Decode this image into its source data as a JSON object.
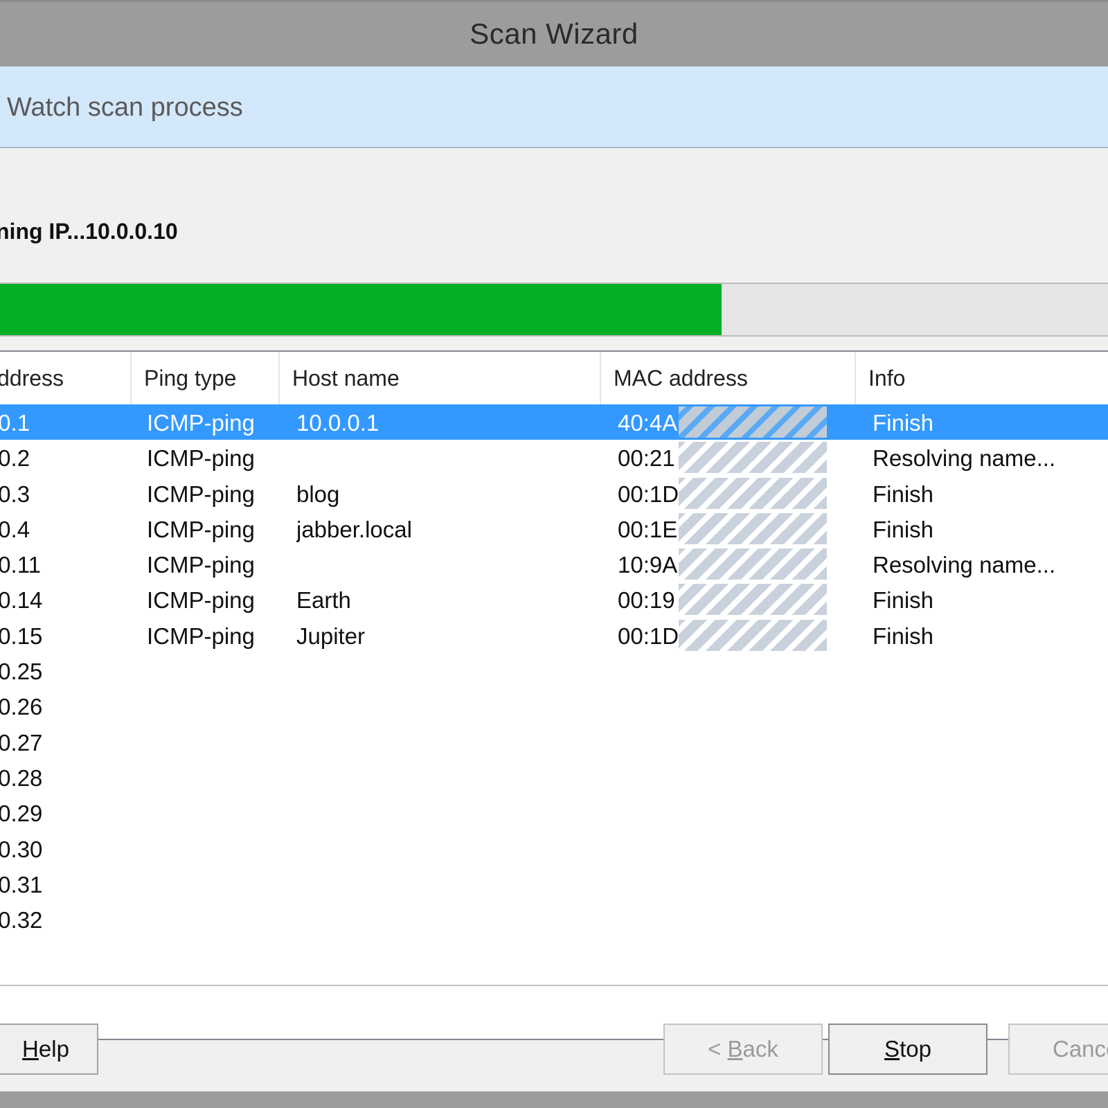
{
  "window": {
    "title": "Scan Wizard"
  },
  "banner": {
    "text": "Watch scan process"
  },
  "status": {
    "text": "ning IP...10.0.0.10"
  },
  "progress": {
    "fraction": 0.65,
    "fill_color": "#06b025"
  },
  "table": {
    "columns": [
      "ddress",
      "Ping type",
      "Host name",
      "MAC address",
      "Info"
    ],
    "rows": [
      {
        "address": ".0.1",
        "ping": "ICMP-ping",
        "host": "10.0.0.1",
        "mac": "40:4A",
        "info": "Finish",
        "selected": true
      },
      {
        "address": ".0.2",
        "ping": "ICMP-ping",
        "host": "",
        "mac": "00:21",
        "info": "Resolving name..."
      },
      {
        "address": ".0.3",
        "ping": "ICMP-ping",
        "host": "blog",
        "mac": "00:1D",
        "info": "Finish"
      },
      {
        "address": ".0.4",
        "ping": "ICMP-ping",
        "host": "jabber.local",
        "mac": "00:1E",
        "info": "Finish"
      },
      {
        "address": ".0.11",
        "ping": "ICMP-ping",
        "host": "",
        "mac": "10:9A",
        "info": "Resolving name..."
      },
      {
        "address": ".0.14",
        "ping": "ICMP-ping",
        "host": "Earth",
        "mac": "00:19",
        "info": "Finish"
      },
      {
        "address": ".0.15",
        "ping": "ICMP-ping",
        "host": "Jupiter",
        "mac": "00:1D",
        "info": "Finish"
      },
      {
        "address": ".0.25",
        "ping": "",
        "host": "",
        "mac": "",
        "info": ""
      },
      {
        "address": ".0.26",
        "ping": "",
        "host": "",
        "mac": "",
        "info": ""
      },
      {
        "address": ".0.27",
        "ping": "",
        "host": "",
        "mac": "",
        "info": ""
      },
      {
        "address": ".0.28",
        "ping": "",
        "host": "",
        "mac": "",
        "info": ""
      },
      {
        "address": ".0.29",
        "ping": "",
        "host": "",
        "mac": "",
        "info": ""
      },
      {
        "address": ".0.30",
        "ping": "",
        "host": "",
        "mac": "",
        "info": ""
      },
      {
        "address": ".0.31",
        "ping": "",
        "host": "",
        "mac": "",
        "info": ""
      },
      {
        "address": ".0.32",
        "ping": "",
        "host": "",
        "mac": "",
        "info": ""
      }
    ]
  },
  "buttons": {
    "help": {
      "prefix": "",
      "accel": "H",
      "rest": "elp"
    },
    "back": {
      "prefix": "< ",
      "accel": "B",
      "rest": "ack"
    },
    "stop": {
      "prefix": "",
      "accel": "S",
      "rest": "top"
    },
    "cancel": {
      "label": "Cance"
    }
  }
}
